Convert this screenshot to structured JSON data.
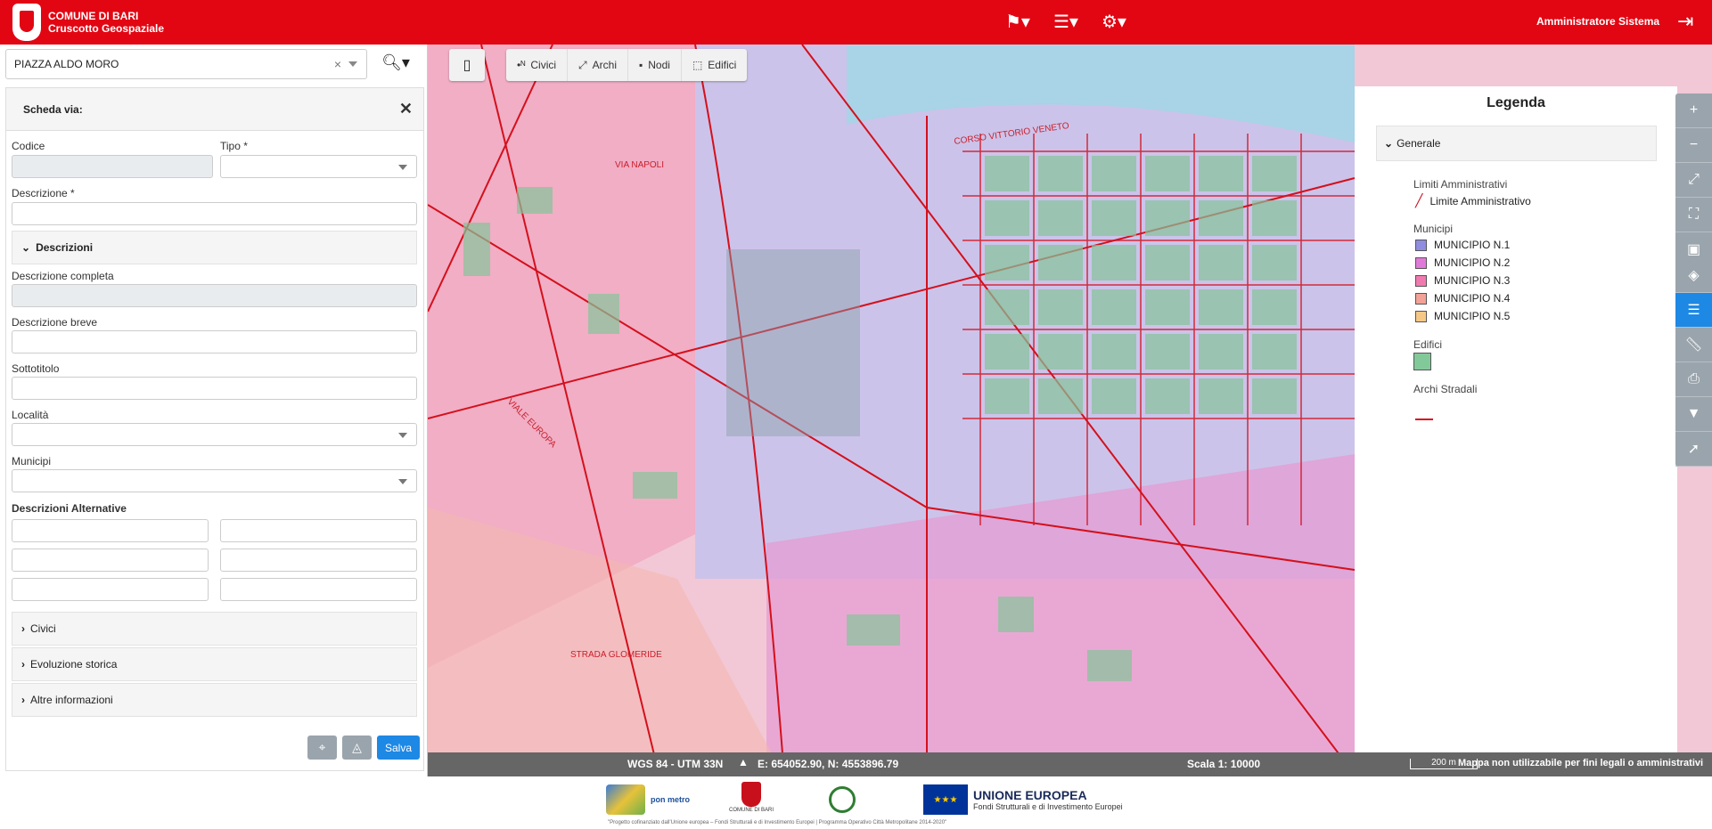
{
  "header": {
    "org": "COMUNE DI BARI",
    "app": "Cruscotto Geospaziale",
    "user": "Amministratore Sistema",
    "icons": [
      "signpost-icon",
      "list-icon",
      "gear-icon",
      "logout-icon"
    ]
  },
  "search": {
    "value": "PIAZZA ALDO MORO"
  },
  "panel": {
    "title": "Scheda via:",
    "codice_label": "Codice",
    "tipo_label": "Tipo *",
    "descrizione_label": "Descrizione *",
    "descrizioni_section": "Descrizioni",
    "descrizione_completa_label": "Descrizione completa",
    "descrizione_breve_label": "Descrizione breve",
    "sottotitolo_label": "Sottotitolo",
    "localita_label": "Località",
    "municipi_label": "Municipi",
    "alt_label": "Descrizioni Alternative",
    "sections": [
      "Civici",
      "Evoluzione storica",
      "Altre informazioni"
    ],
    "save_label": "Salva"
  },
  "map_toolbar": {
    "items": [
      "Civici",
      "Archi",
      "Nodi",
      "Edifici"
    ]
  },
  "legend": {
    "title": "Legenda",
    "group": "Generale",
    "limits_title": "Limiti Amministrativi",
    "limits_item": "Limite Amministrativo",
    "municipi_title": "Municipi",
    "municipi": [
      {
        "label": "MUNICIPIO N.1",
        "color": "#8f8de0"
      },
      {
        "label": "MUNICIPIO N.2",
        "color": "#e07ad8"
      },
      {
        "label": "MUNICIPIO N.3",
        "color": "#f07ab0"
      },
      {
        "label": "MUNICIPIO N.4",
        "color": "#f2a296"
      },
      {
        "label": "MUNICIPIO N.5",
        "color": "#f5c888"
      }
    ],
    "edifici_title": "Edifici",
    "edifici_color": "#82c99a",
    "archi_title": "Archi Stradali"
  },
  "status": {
    "crs": "WGS 84 - UTM 33N",
    "coords": "E: 654052.90, N: 4553896.79",
    "scalebar": "200 m",
    "scale": "Scala 1: 10000",
    "disclaimer": "Mappa non utilizzabile per fini legali o amministrativi"
  },
  "footer": {
    "eu": "UNIONE EUROPEA",
    "eu_sub": "Fondi Strutturali e di Investimento Europei",
    "pon": "pon metro",
    "comune": "COMUNE DI BARI",
    "note": "\"Progetto cofinanziato dall'Unione europea – Fondi Strutturali e di Investimento Europei | Programma Operativo Città Metropolitane 2014-2020\""
  },
  "map_labels": [
    "CORSO VITTORIO VENETO",
    "VIA NAPOLI",
    "VIALE EUROPA",
    "STRADA GLOMERIDE"
  ]
}
